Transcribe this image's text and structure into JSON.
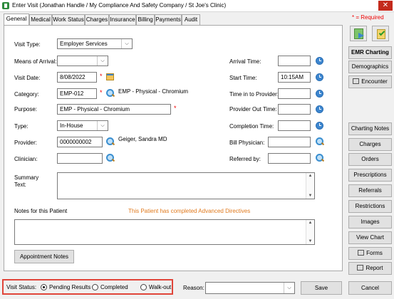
{
  "window": {
    "title": "Enter Visit (Jonathan Handle / My Compliance And Safety Company / St Joe's Clinic)",
    "close": "✕"
  },
  "tabs": [
    "General",
    "Medical",
    "Work Status",
    "Charges",
    "Insurance",
    "Billing",
    "Payments",
    "Audit"
  ],
  "form": {
    "visit_type_label": "Visit Type:",
    "visit_type_value": "Employer Services",
    "means_label": "Means of Arrival:",
    "means_value": "",
    "visit_date_label": "Visit Date:",
    "visit_date_value": "8/08/2022",
    "category_label": "Category:",
    "category_value": "EMP-012",
    "category_desc": "EMP - Physical - Chromium",
    "purpose_label": "Purpose:",
    "purpose_value": "EMP - Physical - Chromium",
    "type_label": "Type:",
    "type_value": "In-House",
    "provider_label": "Provider:",
    "provider_value": "0000000002",
    "provider_name": "Geiger, Sandra  MD",
    "clinician_label": "Clinician:",
    "clinician_value": "",
    "arrival_label": "Arrival Time:",
    "arrival_value": "",
    "start_label": "Start Time:",
    "start_value": "10:15AM",
    "time_in_label": "Time in to Provider:",
    "time_in_value": "",
    "provider_out_label": "Provider Out Time:",
    "provider_out_value": "",
    "completion_label": "Completion Time:",
    "completion_value": "",
    "bill_physician_label": "Bill Physician:",
    "bill_physician_value": "",
    "referred_label": "Referred by:",
    "referred_value": "",
    "summary_label": "Summary\nText:",
    "notes_label": "Notes for this Patient",
    "advanced_directives": "This Patient has completed Advanced Directives",
    "appointment_notes": "Appointment Notes",
    "required_mark": "*"
  },
  "sidebar": {
    "required_note": "* = Required",
    "emr_charting": "EMR Charting",
    "demographics": "Demographics",
    "encounter": "Encounter",
    "charting_notes": "Charting Notes",
    "charges": "Charges",
    "orders": "Orders",
    "prescriptions": "Prescriptions",
    "referrals": "Referrals",
    "restrictions": "Restrictions",
    "images": "Images",
    "view_chart": "View Chart",
    "forms": "Forms",
    "report": "Report"
  },
  "footer": {
    "status_label": "Visit Status:",
    "options": [
      "Pending Results",
      "Completed",
      "Walk-out"
    ],
    "selected": "Pending Results",
    "reason_label": "Reason:",
    "reason_value": "",
    "save": "Save",
    "cancel": "Cancel"
  },
  "colors": {
    "required": "#e00000",
    "accent_orange": "#e07a1e",
    "highlight_border": "#e0453a"
  }
}
